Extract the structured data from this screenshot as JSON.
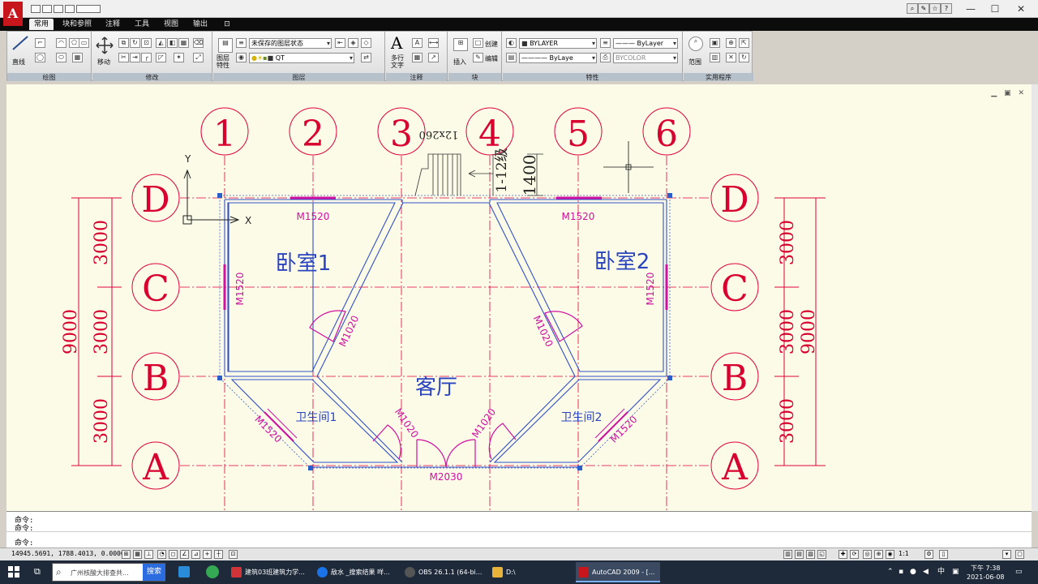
{
  "app": {
    "logo_letter": "A",
    "accent": "#c8161d"
  },
  "titlebar": {
    "tools": [
      "search-icon",
      "pin-icon",
      "star-icon",
      "help-icon"
    ],
    "window_controls": [
      "—",
      "☐",
      "✕"
    ]
  },
  "tabs": [
    "常用",
    "块和参照",
    "注释",
    "工具",
    "视图",
    "输出",
    "⊡"
  ],
  "ribbon": {
    "panels": [
      {
        "title": "绘图",
        "labels": [
          "直线"
        ]
      },
      {
        "title": "修改",
        "labels": [
          "移动"
        ]
      },
      {
        "title": "图层",
        "labels": [
          "图层特性"
        ],
        "layer_state": "未保存的图层状态",
        "current_layer": "QT"
      },
      {
        "title": "注释",
        "labels": [
          "多行文字"
        ]
      },
      {
        "title": "块",
        "labels": [
          "插入",
          "创建",
          "编辑"
        ]
      },
      {
        "title": "特性",
        "color": "BYLAYER",
        "linetype_top": "ByLayer",
        "linetype": "ByLaye",
        "plot_style": "BYCOLOR"
      },
      {
        "title": "实用程序",
        "labels": [
          "范围"
        ]
      }
    ]
  },
  "drawing": {
    "axes": {
      "columns": [
        "1",
        "2",
        "3",
        "4",
        "5",
        "6"
      ],
      "rows": [
        "D",
        "C",
        "B",
        "A"
      ]
    },
    "ucs": {
      "x": "X",
      "y": "Y"
    },
    "dims": {
      "left_segments": [
        "3000",
        "3000",
        "3000"
      ],
      "left_total": "9000",
      "right_segments": [
        "3000",
        "3000",
        "3000"
      ],
      "right_total": "9000",
      "stair_height": "1400"
    },
    "rooms": [
      "卧室1",
      "卧室2",
      "客厅",
      "卫生间1",
      "卫生间2"
    ],
    "doors": [
      "M1520",
      "M1520",
      "M1520",
      "M1520",
      "M1520",
      "M1520",
      "M1020",
      "M1020",
      "M1020",
      "M1020",
      "M2030"
    ],
    "stair_text": "12x260",
    "stair_label": "1-12级"
  },
  "command": {
    "lines": [
      "命令:",
      "命令:",
      "命令:"
    ],
    "coordinates": "14945.5691, 1788.4013, 0.0000"
  },
  "status_bar": {
    "scale": "1:1"
  },
  "taskbar": {
    "search_placeholder": "广州核酸大排查共...",
    "search_button": "搜索",
    "items": [
      {
        "label": "建筑03班建筑力学...",
        "color": "#d13438"
      },
      {
        "label": "敌水 _搜索结果 咩...",
        "color": "#1a73e8"
      },
      {
        "label": "OBS 26.1.1 (64-bi...",
        "color": "#333"
      },
      {
        "label": "D:\\",
        "color": "#e8b339"
      },
      {
        "label": "AutoCAD 2009 - [...",
        "color": "#c8161d"
      }
    ],
    "time": "下午 7:38",
    "date": "2021-06-08",
    "ime": "中"
  }
}
